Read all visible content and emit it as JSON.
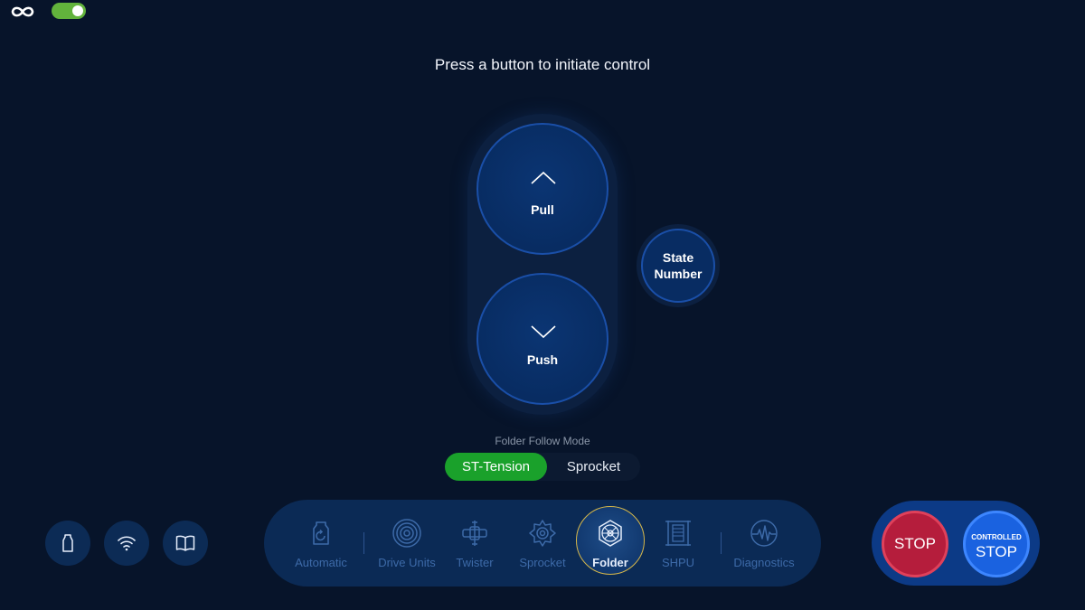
{
  "header": {
    "prompt": "Press a button to initiate control",
    "connection_toggle_on": true
  },
  "controls": {
    "pull_label": "Pull",
    "push_label": "Push",
    "state_label": "State Number"
  },
  "follow_mode": {
    "title": "Folder Follow Mode",
    "options": [
      "ST-Tension",
      "Sprocket"
    ],
    "selected": "ST-Tension"
  },
  "quick_actions": [
    {
      "icon": "bottle-icon"
    },
    {
      "icon": "wifi-icon"
    },
    {
      "icon": "book-icon"
    }
  ],
  "nav": {
    "items": [
      {
        "label": "Automatic",
        "icon": "automatic-icon"
      },
      {
        "label": "Drive Units",
        "icon": "drive-units-icon"
      },
      {
        "label": "Twister",
        "icon": "twister-icon"
      },
      {
        "label": "Sprocket",
        "icon": "sprocket-icon"
      },
      {
        "label": "Folder",
        "icon": "folder-icon"
      },
      {
        "label": "SHPU",
        "icon": "shpu-icon"
      },
      {
        "label": "Diagnostics",
        "icon": "diagnostics-icon"
      }
    ],
    "selected": "Folder"
  },
  "stop_panel": {
    "stop_label": "STOP",
    "controlled_label": "CONTROLLED",
    "controlled_stop_label": "STOP"
  },
  "colors": {
    "background": "#07142a",
    "accent_green": "#1aa12b",
    "stop_red": "#b51d3c",
    "controlled_blue": "#1a62e0",
    "nav_selected_ring": "#d7b84a"
  }
}
